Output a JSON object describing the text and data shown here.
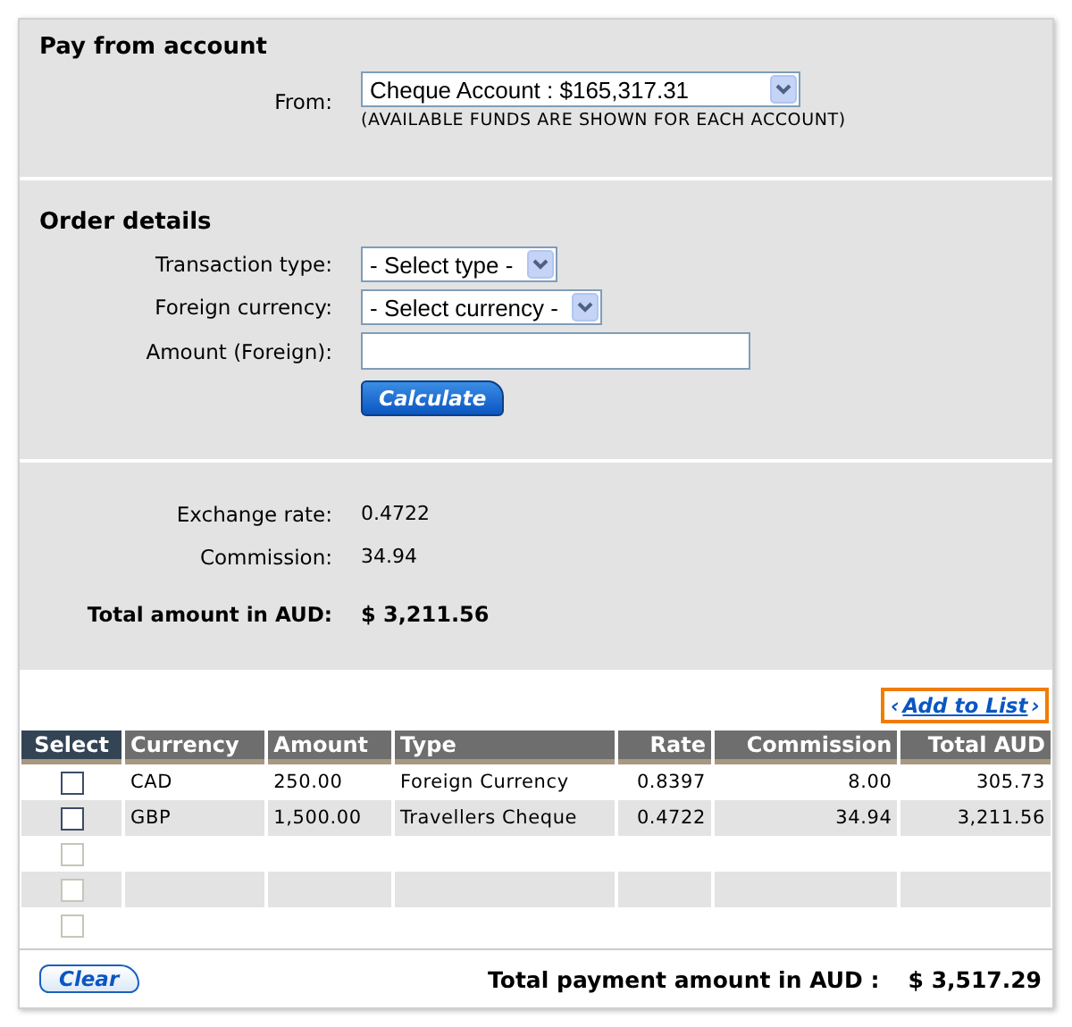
{
  "pay_from_account": {
    "title": "Pay from account",
    "from_label": "From:",
    "from_value": "Cheque Account : $165,317.31",
    "note": "(AVAILABLE FUNDS ARE SHOWN FOR EACH ACCOUNT)"
  },
  "order_details": {
    "title": "Order details",
    "fields": [
      {
        "kind": "select",
        "label": "Transaction type:",
        "value": "- Select type -"
      },
      {
        "kind": "select",
        "label": "Foreign currency:",
        "value": "- Select currency -"
      },
      {
        "kind": "input",
        "label": "Amount (Foreign):"
      }
    ],
    "calculate_button": "Calculate"
  },
  "summary": {
    "rows": [
      {
        "label": "Exchange rate:",
        "value": "0.4722",
        "bold": false
      },
      {
        "label": "Commission:",
        "value": "34.94",
        "bold": false
      },
      {
        "label": "Total amount in AUD:",
        "value": "$ 3,211.56",
        "bold": true
      }
    ]
  },
  "add_to_list": {
    "left": "‹",
    "label": "Add to List",
    "right": "›"
  },
  "table": {
    "columns": [
      "Select",
      "Currency",
      "Amount",
      "Type",
      "Rate",
      "Commission",
      "Total AUD"
    ],
    "rows": [
      {
        "checked": false,
        "disabled": false,
        "cells": [
          "",
          "CAD",
          "250.00",
          "Foreign Currency",
          "0.8397",
          "8.00",
          "305.73"
        ]
      },
      {
        "checked": false,
        "disabled": false,
        "cells": [
          "",
          "GBP",
          "1,500.00",
          "Travellers Cheque",
          "0.4722",
          "34.94",
          "3,211.56"
        ]
      },
      {
        "checked": false,
        "disabled": true
      },
      {
        "checked": false,
        "disabled": true
      },
      {
        "checked": false,
        "disabled": true
      }
    ]
  },
  "clear_button": "Clear",
  "total_payment": {
    "label": "Total payment amount in AUD :",
    "value": "$ 3,517.29"
  }
}
